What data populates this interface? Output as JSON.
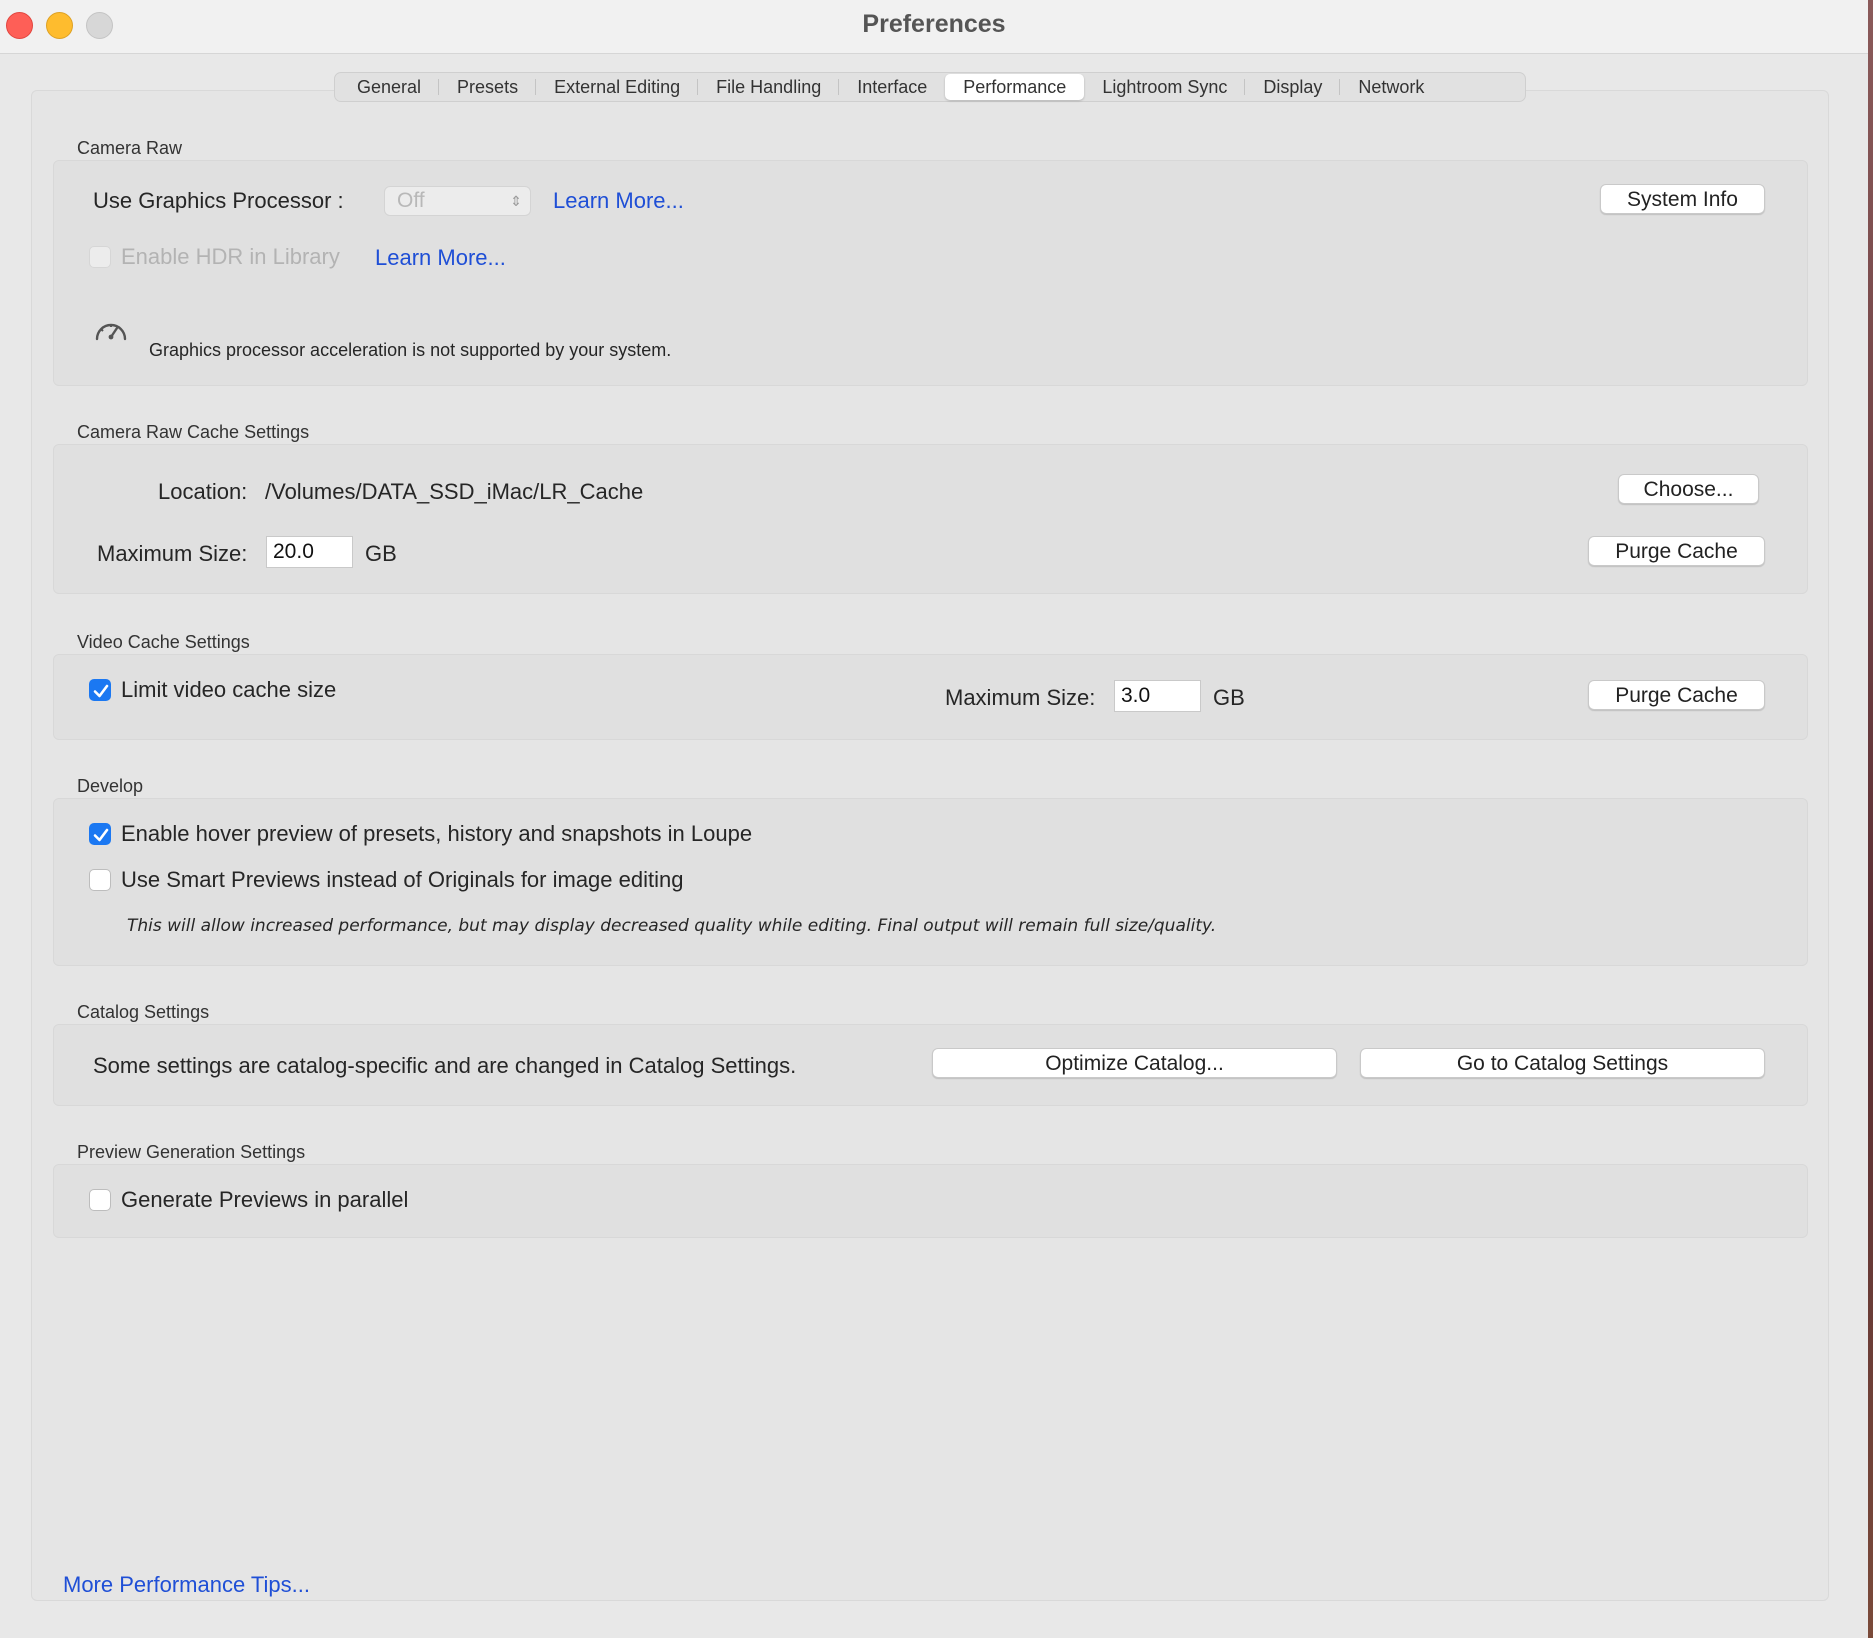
{
  "window": {
    "title": "Preferences"
  },
  "tabs": [
    {
      "label": "General",
      "active": false
    },
    {
      "label": "Presets",
      "active": false
    },
    {
      "label": "External Editing",
      "active": false
    },
    {
      "label": "File Handling",
      "active": false
    },
    {
      "label": "Interface",
      "active": false
    },
    {
      "label": "Performance",
      "active": true
    },
    {
      "label": "Lightroom Sync",
      "active": false
    },
    {
      "label": "Display",
      "active": false
    },
    {
      "label": "Network",
      "active": false
    }
  ],
  "camera_raw": {
    "heading": "Camera Raw",
    "gpu_label": "Use Graphics Processor :",
    "gpu_value": "Off",
    "learn_more_1": "Learn More...",
    "system_info": "System Info",
    "hdr_label": "Enable HDR in Library",
    "hdr_checked": false,
    "learn_more_2": "Learn More...",
    "notice": "Graphics processor acceleration is not supported by your system.",
    "notice_icon": "speedometer-icon"
  },
  "cache": {
    "heading": "Camera Raw Cache Settings",
    "location_label": "Location:",
    "location_value": "/Volumes/DATA_SSD_iMac/LR_Cache",
    "choose": "Choose...",
    "max_label": "Maximum Size:",
    "max_value": "20.0",
    "unit": "GB",
    "purge": "Purge Cache"
  },
  "video_cache": {
    "heading": "Video Cache Settings",
    "limit_label": "Limit video cache size",
    "limit_checked": true,
    "max_label": "Maximum Size:",
    "max_value": "3.0",
    "unit": "GB",
    "purge": "Purge Cache"
  },
  "develop": {
    "heading": "Develop",
    "hover_label": "Enable hover preview of presets, history and snapshots in Loupe",
    "hover_checked": true,
    "smart_label": "Use Smart Previews instead of Originals for image editing",
    "smart_checked": false,
    "note": "This will allow increased performance, but may display decreased quality while editing. Final output will remain full size/quality."
  },
  "catalog": {
    "heading": "Catalog Settings",
    "text": "Some settings are catalog-specific and are changed in Catalog Settings.",
    "optimize": "Optimize Catalog...",
    "goto": "Go to Catalog Settings"
  },
  "preview": {
    "heading": "Preview Generation Settings",
    "parallel_label": "Generate Previews in parallel",
    "parallel_checked": false
  },
  "footer": {
    "tips_link": "More Performance Tips..."
  },
  "colors": {
    "accent": "#1b78f2",
    "link": "#1f4fd6"
  }
}
